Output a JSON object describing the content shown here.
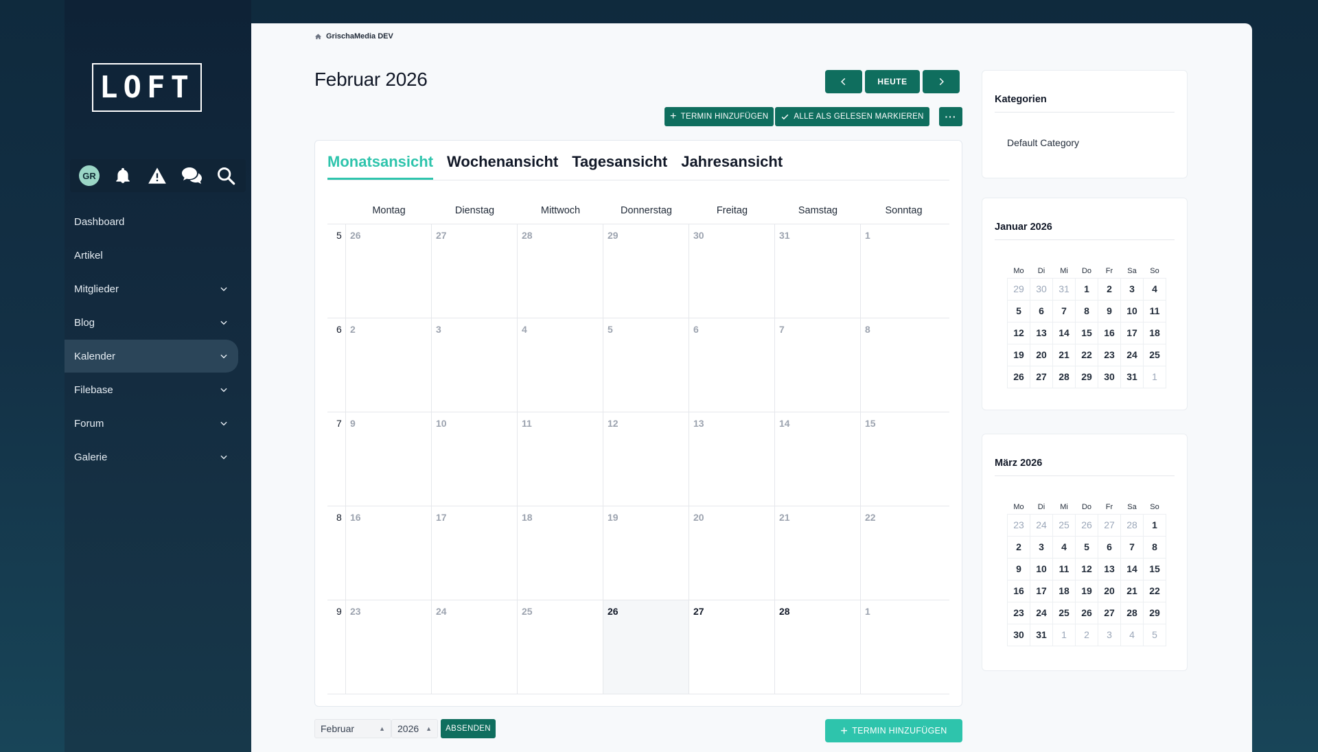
{
  "sidebar": {
    "logo": "LOFT",
    "avatar": "GR",
    "items": [
      {
        "label": "Dashboard",
        "has_children": false
      },
      {
        "label": "Artikel",
        "has_children": false
      },
      {
        "label": "Mitglieder",
        "has_children": true
      },
      {
        "label": "Blog",
        "has_children": true
      },
      {
        "label": "Kalender",
        "has_children": true,
        "active": true
      },
      {
        "label": "Filebase",
        "has_children": true
      },
      {
        "label": "Forum",
        "has_children": true
      },
      {
        "label": "Galerie",
        "has_children": true
      }
    ]
  },
  "breadcrumb": "GrischaMedia DEV",
  "header": {
    "title": "Februar 2026",
    "today_label": "HEUTE",
    "add_event_label": "TERMIN HINZUFÜGEN",
    "mark_read_label": "ALLE ALS GELESEN MARKIEREN"
  },
  "tabs": [
    "Monatsansicht",
    "Wochenansicht",
    "Tagesansicht",
    "Jahresansicht"
  ],
  "calendar": {
    "weekdays": [
      "Montag",
      "Dienstag",
      "Mittwoch",
      "Donnerstag",
      "Freitag",
      "Samstag",
      "Sonntag"
    ],
    "weeks": [
      {
        "week": "5",
        "days": [
          [
            "26",
            0
          ],
          [
            "27",
            0
          ],
          [
            "28",
            0
          ],
          [
            "29",
            0
          ],
          [
            "30",
            0
          ],
          [
            "31",
            0
          ],
          [
            "1",
            0
          ]
        ]
      },
      {
        "week": "6",
        "days": [
          [
            "2",
            0
          ],
          [
            "3",
            0
          ],
          [
            "4",
            0
          ],
          [
            "5",
            0
          ],
          [
            "6",
            0
          ],
          [
            "7",
            0
          ],
          [
            "8",
            0
          ]
        ]
      },
      {
        "week": "7",
        "days": [
          [
            "9",
            0
          ],
          [
            "10",
            0
          ],
          [
            "11",
            0
          ],
          [
            "12",
            0
          ],
          [
            "13",
            0
          ],
          [
            "14",
            0
          ],
          [
            "15",
            0
          ]
        ]
      },
      {
        "week": "8",
        "days": [
          [
            "16",
            0
          ],
          [
            "17",
            0
          ],
          [
            "18",
            0
          ],
          [
            "19",
            0
          ],
          [
            "20",
            0
          ],
          [
            "21",
            0
          ],
          [
            "22",
            0
          ]
        ]
      },
      {
        "week": "9",
        "days": [
          [
            "23",
            0
          ],
          [
            "24",
            0
          ],
          [
            "25",
            0
          ],
          [
            "26",
            2
          ],
          [
            "27",
            1
          ],
          [
            "28",
            1
          ],
          [
            "1",
            0
          ]
        ]
      }
    ]
  },
  "footer": {
    "month_value": "Februar",
    "year_value": "2026",
    "submit_label": "ABSENDEN",
    "add_event_label": "TERMIN HINZUFÜGEN"
  },
  "categories": {
    "title": "Kategorien",
    "items": [
      "Default Category"
    ]
  },
  "mini_calendars": [
    {
      "title": "Januar 2026",
      "headers": [
        "Mo",
        "Di",
        "Mi",
        "Do",
        "Fr",
        "Sa",
        "So"
      ],
      "rows": [
        [
          [
            "29",
            0
          ],
          [
            "30",
            0
          ],
          [
            "31",
            0
          ],
          [
            "1",
            1
          ],
          [
            "2",
            1
          ],
          [
            "3",
            1
          ],
          [
            "4",
            1
          ]
        ],
        [
          [
            "5",
            1
          ],
          [
            "6",
            1
          ],
          [
            "7",
            1
          ],
          [
            "8",
            1
          ],
          [
            "9",
            1
          ],
          [
            "10",
            1
          ],
          [
            "11",
            1
          ]
        ],
        [
          [
            "12",
            1
          ],
          [
            "13",
            1
          ],
          [
            "14",
            1
          ],
          [
            "15",
            1
          ],
          [
            "16",
            1
          ],
          [
            "17",
            1
          ],
          [
            "18",
            1
          ]
        ],
        [
          [
            "19",
            1
          ],
          [
            "20",
            1
          ],
          [
            "21",
            1
          ],
          [
            "22",
            1
          ],
          [
            "23",
            1
          ],
          [
            "24",
            1
          ],
          [
            "25",
            1
          ]
        ],
        [
          [
            "26",
            1
          ],
          [
            "27",
            1
          ],
          [
            "28",
            1
          ],
          [
            "29",
            1
          ],
          [
            "30",
            1
          ],
          [
            "31",
            1
          ],
          [
            "1",
            0
          ]
        ]
      ]
    },
    {
      "title": "März 2026",
      "headers": [
        "Mo",
        "Di",
        "Mi",
        "Do",
        "Fr",
        "Sa",
        "So"
      ],
      "rows": [
        [
          [
            "23",
            0
          ],
          [
            "24",
            0
          ],
          [
            "25",
            0
          ],
          [
            "26",
            0
          ],
          [
            "27",
            0
          ],
          [
            "28",
            0
          ],
          [
            "1",
            1
          ]
        ],
        [
          [
            "2",
            1
          ],
          [
            "3",
            1
          ],
          [
            "4",
            1
          ],
          [
            "5",
            1
          ],
          [
            "6",
            1
          ],
          [
            "7",
            1
          ],
          [
            "8",
            1
          ]
        ],
        [
          [
            "9",
            1
          ],
          [
            "10",
            1
          ],
          [
            "11",
            1
          ],
          [
            "12",
            1
          ],
          [
            "13",
            1
          ],
          [
            "14",
            1
          ],
          [
            "15",
            1
          ]
        ],
        [
          [
            "16",
            1
          ],
          [
            "17",
            1
          ],
          [
            "18",
            1
          ],
          [
            "19",
            1
          ],
          [
            "20",
            1
          ],
          [
            "21",
            1
          ],
          [
            "22",
            1
          ]
        ],
        [
          [
            "23",
            1
          ],
          [
            "24",
            1
          ],
          [
            "25",
            1
          ],
          [
            "26",
            1
          ],
          [
            "27",
            1
          ],
          [
            "28",
            1
          ],
          [
            "29",
            1
          ]
        ],
        [
          [
            "30",
            1
          ],
          [
            "31",
            1
          ],
          [
            "1",
            0
          ],
          [
            "2",
            0
          ],
          [
            "3",
            0
          ],
          [
            "4",
            0
          ],
          [
            "5",
            0
          ]
        ]
      ]
    }
  ],
  "colors": {
    "accent": "#2ec4ac",
    "primary_button": "#0f6e5e",
    "sidebar_bg": "#0e2236",
    "muted_day": "#9ca3af"
  }
}
